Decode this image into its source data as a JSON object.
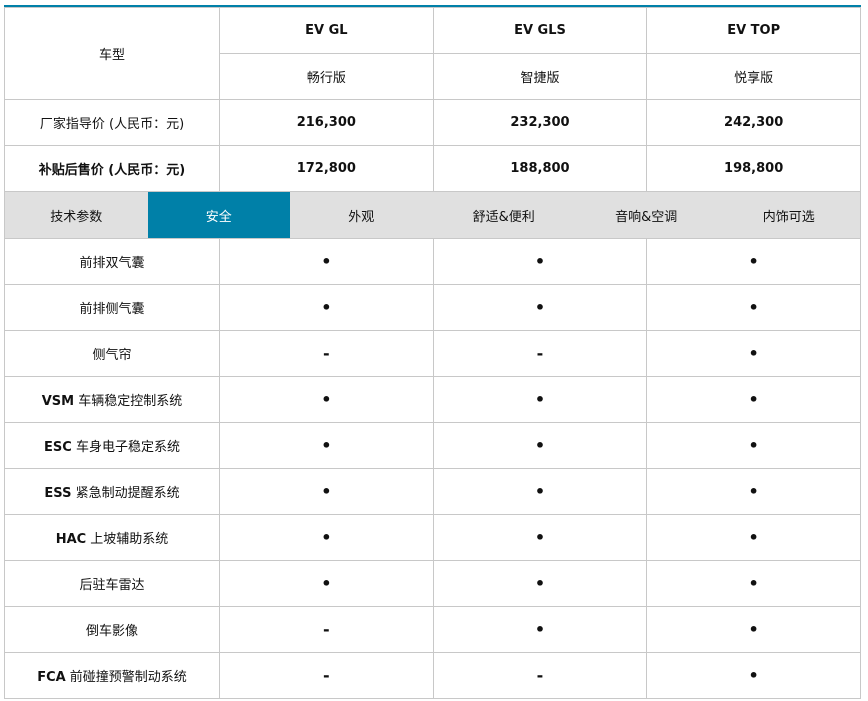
{
  "header": {
    "model_label": "车型",
    "models": [
      {
        "name": "EV GL",
        "trim": "畅行版"
      },
      {
        "name": "EV GLS",
        "trim": "智捷版"
      },
      {
        "name": "EV TOP",
        "trim": "悦享版"
      }
    ]
  },
  "prices": [
    {
      "label": "厂家指导价 (人民币：元)",
      "values": [
        "216,300",
        "232,300",
        "242,300"
      ]
    },
    {
      "label": "补贴后售价 (人民币：元)",
      "values": [
        "172,800",
        "188,800",
        "198,800"
      ]
    }
  ],
  "tabs": [
    {
      "label": "技术参数"
    },
    {
      "label": "安全",
      "active": true
    },
    {
      "label": "外观"
    },
    {
      "label": "舒适&便利"
    },
    {
      "label": "音响&空调"
    },
    {
      "label": "内饰可选"
    }
  ],
  "accent": "#0080a8",
  "features": [
    {
      "prefix": "",
      "label": "前排双气囊",
      "values": [
        "•",
        "•",
        "•"
      ]
    },
    {
      "prefix": "",
      "label": "前排侧气囊",
      "values": [
        "•",
        "•",
        "•"
      ]
    },
    {
      "prefix": "",
      "label": "侧气帘",
      "values": [
        "-",
        "-",
        "•"
      ]
    },
    {
      "prefix": "VSM",
      "label": " 车辆稳定控制系统",
      "values": [
        "•",
        "•",
        "•"
      ]
    },
    {
      "prefix": "ESC",
      "label": " 车身电子稳定系统",
      "values": [
        "•",
        "•",
        "•"
      ]
    },
    {
      "prefix": "ESS",
      "label": " 紧急制动提醒系统",
      "values": [
        "•",
        "•",
        "•"
      ]
    },
    {
      "prefix": "HAC",
      "label": " 上坡辅助系统",
      "values": [
        "•",
        "•",
        "•"
      ]
    },
    {
      "prefix": "",
      "label": "后驻车雷达",
      "values": [
        "•",
        "•",
        "•"
      ]
    },
    {
      "prefix": "",
      "label": "倒车影像",
      "values": [
        "-",
        "•",
        "•"
      ]
    },
    {
      "prefix": "FCA",
      "label": " 前碰撞预警制动系统",
      "values": [
        "-",
        "-",
        "•"
      ]
    }
  ]
}
